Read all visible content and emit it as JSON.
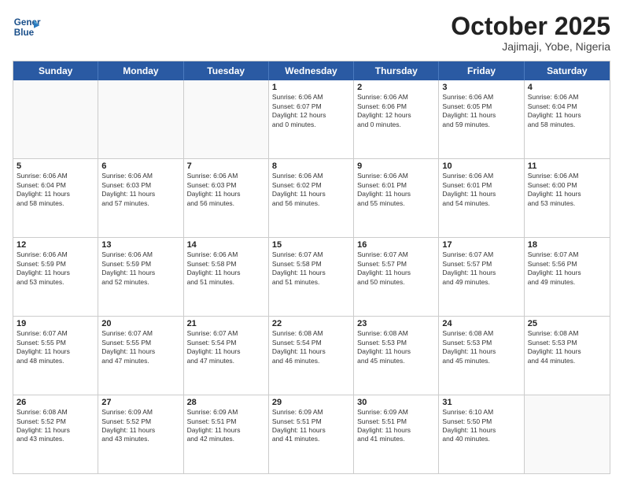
{
  "header": {
    "logo_line1": "General",
    "logo_line2": "Blue",
    "month": "October 2025",
    "location": "Jajimaji, Yobe, Nigeria"
  },
  "weekdays": [
    "Sunday",
    "Monday",
    "Tuesday",
    "Wednesday",
    "Thursday",
    "Friday",
    "Saturday"
  ],
  "rows": [
    [
      {
        "day": "",
        "info": ""
      },
      {
        "day": "",
        "info": ""
      },
      {
        "day": "",
        "info": ""
      },
      {
        "day": "1",
        "info": "Sunrise: 6:06 AM\nSunset: 6:07 PM\nDaylight: 12 hours\nand 0 minutes."
      },
      {
        "day": "2",
        "info": "Sunrise: 6:06 AM\nSunset: 6:06 PM\nDaylight: 12 hours\nand 0 minutes."
      },
      {
        "day": "3",
        "info": "Sunrise: 6:06 AM\nSunset: 6:05 PM\nDaylight: 11 hours\nand 59 minutes."
      },
      {
        "day": "4",
        "info": "Sunrise: 6:06 AM\nSunset: 6:04 PM\nDaylight: 11 hours\nand 58 minutes."
      }
    ],
    [
      {
        "day": "5",
        "info": "Sunrise: 6:06 AM\nSunset: 6:04 PM\nDaylight: 11 hours\nand 58 minutes."
      },
      {
        "day": "6",
        "info": "Sunrise: 6:06 AM\nSunset: 6:03 PM\nDaylight: 11 hours\nand 57 minutes."
      },
      {
        "day": "7",
        "info": "Sunrise: 6:06 AM\nSunset: 6:03 PM\nDaylight: 11 hours\nand 56 minutes."
      },
      {
        "day": "8",
        "info": "Sunrise: 6:06 AM\nSunset: 6:02 PM\nDaylight: 11 hours\nand 56 minutes."
      },
      {
        "day": "9",
        "info": "Sunrise: 6:06 AM\nSunset: 6:01 PM\nDaylight: 11 hours\nand 55 minutes."
      },
      {
        "day": "10",
        "info": "Sunrise: 6:06 AM\nSunset: 6:01 PM\nDaylight: 11 hours\nand 54 minutes."
      },
      {
        "day": "11",
        "info": "Sunrise: 6:06 AM\nSunset: 6:00 PM\nDaylight: 11 hours\nand 53 minutes."
      }
    ],
    [
      {
        "day": "12",
        "info": "Sunrise: 6:06 AM\nSunset: 5:59 PM\nDaylight: 11 hours\nand 53 minutes."
      },
      {
        "day": "13",
        "info": "Sunrise: 6:06 AM\nSunset: 5:59 PM\nDaylight: 11 hours\nand 52 minutes."
      },
      {
        "day": "14",
        "info": "Sunrise: 6:06 AM\nSunset: 5:58 PM\nDaylight: 11 hours\nand 51 minutes."
      },
      {
        "day": "15",
        "info": "Sunrise: 6:07 AM\nSunset: 5:58 PM\nDaylight: 11 hours\nand 51 minutes."
      },
      {
        "day": "16",
        "info": "Sunrise: 6:07 AM\nSunset: 5:57 PM\nDaylight: 11 hours\nand 50 minutes."
      },
      {
        "day": "17",
        "info": "Sunrise: 6:07 AM\nSunset: 5:57 PM\nDaylight: 11 hours\nand 49 minutes."
      },
      {
        "day": "18",
        "info": "Sunrise: 6:07 AM\nSunset: 5:56 PM\nDaylight: 11 hours\nand 49 minutes."
      }
    ],
    [
      {
        "day": "19",
        "info": "Sunrise: 6:07 AM\nSunset: 5:55 PM\nDaylight: 11 hours\nand 48 minutes."
      },
      {
        "day": "20",
        "info": "Sunrise: 6:07 AM\nSunset: 5:55 PM\nDaylight: 11 hours\nand 47 minutes."
      },
      {
        "day": "21",
        "info": "Sunrise: 6:07 AM\nSunset: 5:54 PM\nDaylight: 11 hours\nand 47 minutes."
      },
      {
        "day": "22",
        "info": "Sunrise: 6:08 AM\nSunset: 5:54 PM\nDaylight: 11 hours\nand 46 minutes."
      },
      {
        "day": "23",
        "info": "Sunrise: 6:08 AM\nSunset: 5:53 PM\nDaylight: 11 hours\nand 45 minutes."
      },
      {
        "day": "24",
        "info": "Sunrise: 6:08 AM\nSunset: 5:53 PM\nDaylight: 11 hours\nand 45 minutes."
      },
      {
        "day": "25",
        "info": "Sunrise: 6:08 AM\nSunset: 5:53 PM\nDaylight: 11 hours\nand 44 minutes."
      }
    ],
    [
      {
        "day": "26",
        "info": "Sunrise: 6:08 AM\nSunset: 5:52 PM\nDaylight: 11 hours\nand 43 minutes."
      },
      {
        "day": "27",
        "info": "Sunrise: 6:09 AM\nSunset: 5:52 PM\nDaylight: 11 hours\nand 43 minutes."
      },
      {
        "day": "28",
        "info": "Sunrise: 6:09 AM\nSunset: 5:51 PM\nDaylight: 11 hours\nand 42 minutes."
      },
      {
        "day": "29",
        "info": "Sunrise: 6:09 AM\nSunset: 5:51 PM\nDaylight: 11 hours\nand 41 minutes."
      },
      {
        "day": "30",
        "info": "Sunrise: 6:09 AM\nSunset: 5:51 PM\nDaylight: 11 hours\nand 41 minutes."
      },
      {
        "day": "31",
        "info": "Sunrise: 6:10 AM\nSunset: 5:50 PM\nDaylight: 11 hours\nand 40 minutes."
      },
      {
        "day": "",
        "info": ""
      }
    ]
  ]
}
